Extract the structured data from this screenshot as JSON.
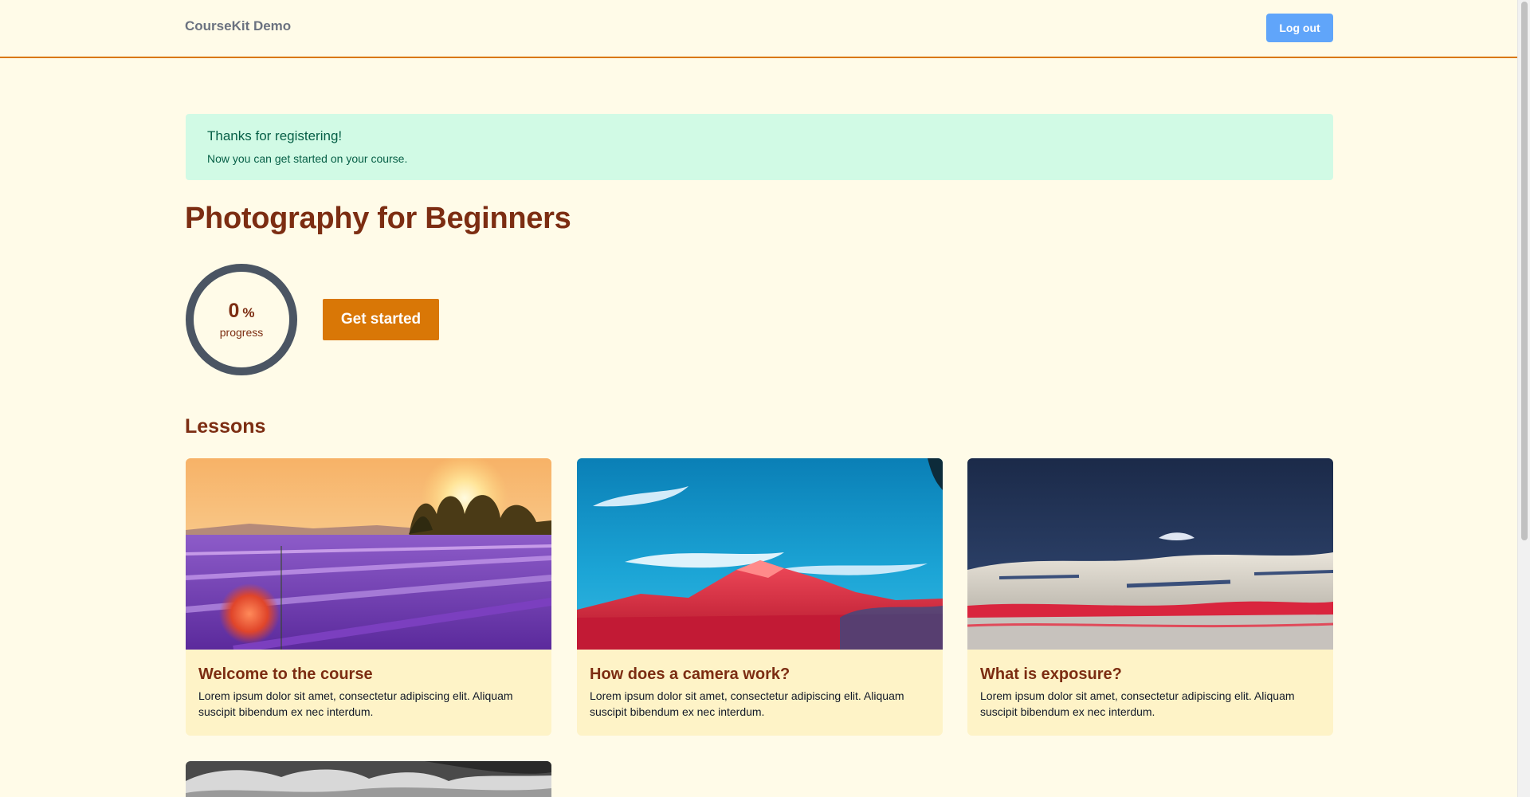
{
  "header": {
    "brand": "CourseKit Demo",
    "logout_label": "Log out"
  },
  "alert": {
    "title": "Thanks for registering!",
    "body": "Now you can get started on your course."
  },
  "course": {
    "title": "Photography for Beginners",
    "progress_value": "0",
    "progress_unit": "%",
    "progress_label": "progress",
    "progress_fraction": 0,
    "cta_label": "Get started"
  },
  "lessons": {
    "heading": "Lessons",
    "items": [
      {
        "title": "Welcome to the course",
        "description": "Lorem ipsum dolor sit amet, consectetur adipiscing elit. Aliquam suscipit bibendum ex nec interdum.",
        "image": "lavender-field-sunset-photo"
      },
      {
        "title": "How does a camera work?",
        "description": "Lorem ipsum dolor sit amet, consectetur adipiscing elit. Aliquam suscipit bibendum ex nec interdum.",
        "image": "red-mountain-blue-sky-photo"
      },
      {
        "title": "What is exposure?",
        "description": "Lorem ipsum dolor sit amet, consectetur adipiscing elit. Aliquam suscipit bibendum ex nec interdum.",
        "image": "clouds-over-red-field-photo"
      },
      {
        "title": "",
        "description": "",
        "image": "black-and-white-clouds-photo"
      }
    ]
  },
  "colors": {
    "page_background": "#fffbe8",
    "accent": "#d97706",
    "heading": "#7c2d12",
    "alert_background": "#d1fae5",
    "logout_button": "#60a5fa",
    "card_background": "#fef3c7"
  }
}
